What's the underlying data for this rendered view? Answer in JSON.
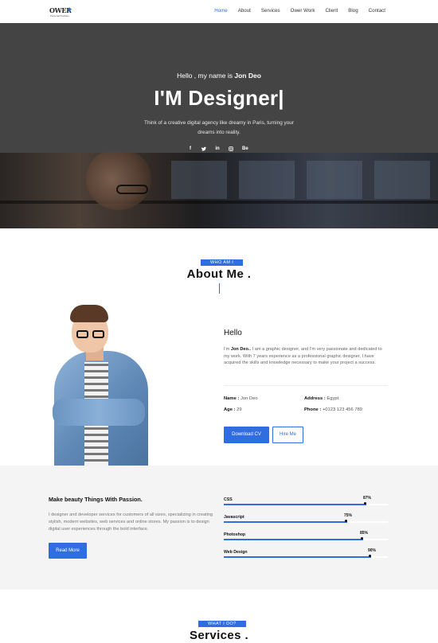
{
  "nav": {
    "logo_main": "OWER",
    "logo_sub": "Personal Portfolio",
    "links": [
      "Home",
      "About",
      "Services",
      "Ower Work",
      "Client",
      "Blog",
      "Contact"
    ]
  },
  "hero": {
    "greeting_prefix": "Hello , my name is",
    "name": "Jon Deo",
    "title": "I'M Designer|",
    "description": "Think of a creative digital agency like dreamy in Paris, turning your dreams into reality.",
    "social": [
      "f",
      "t",
      "in",
      "ig",
      "Be"
    ]
  },
  "about": {
    "tag": "WHO AM I",
    "title": "About Me .",
    "hello": "Hello",
    "intro_prefix": "I'm",
    "intro_name": "Jon Deo..",
    "text": "I am a graphic designer, and I'm very passionate and dedicated to my work. With 7 years experience as a professional graphic designer, I have acquired the skills and knowledge necessary to make your project a success.",
    "name_label": "Name :",
    "name_value": "Jon Deo",
    "address_label": "Address :",
    "address_value": "Egypt",
    "age_label": "Age :",
    "age_value": "29",
    "phone_label": "Phone :",
    "phone_value": "+0123 123 456 789",
    "btn_cv": "Download CV",
    "btn_hire": "Hire Me"
  },
  "skills": {
    "title": "Make beauty Things With Passion.",
    "text": "I designer and developer services for customers of all sizes, specializing in creating stylish, modern websites, web services and online stores. My passion is to design digital user experiences through the bold interface.",
    "btn": "Read More",
    "items": [
      {
        "name": "CSS",
        "percent": 87,
        "label": "87%"
      },
      {
        "name": "Javascript",
        "percent": 75,
        "label": "75%"
      },
      {
        "name": "Photoshop",
        "percent": 85,
        "label": "85%"
      },
      {
        "name": "Web Design",
        "percent": 90,
        "label": "90%"
      }
    ]
  },
  "services": {
    "tag": "WHAT I DO?",
    "title": "Services ."
  },
  "colors": {
    "accent": "#2f6de1",
    "hero_bg": "#444444",
    "band_bg": "#f4f4f4"
  }
}
